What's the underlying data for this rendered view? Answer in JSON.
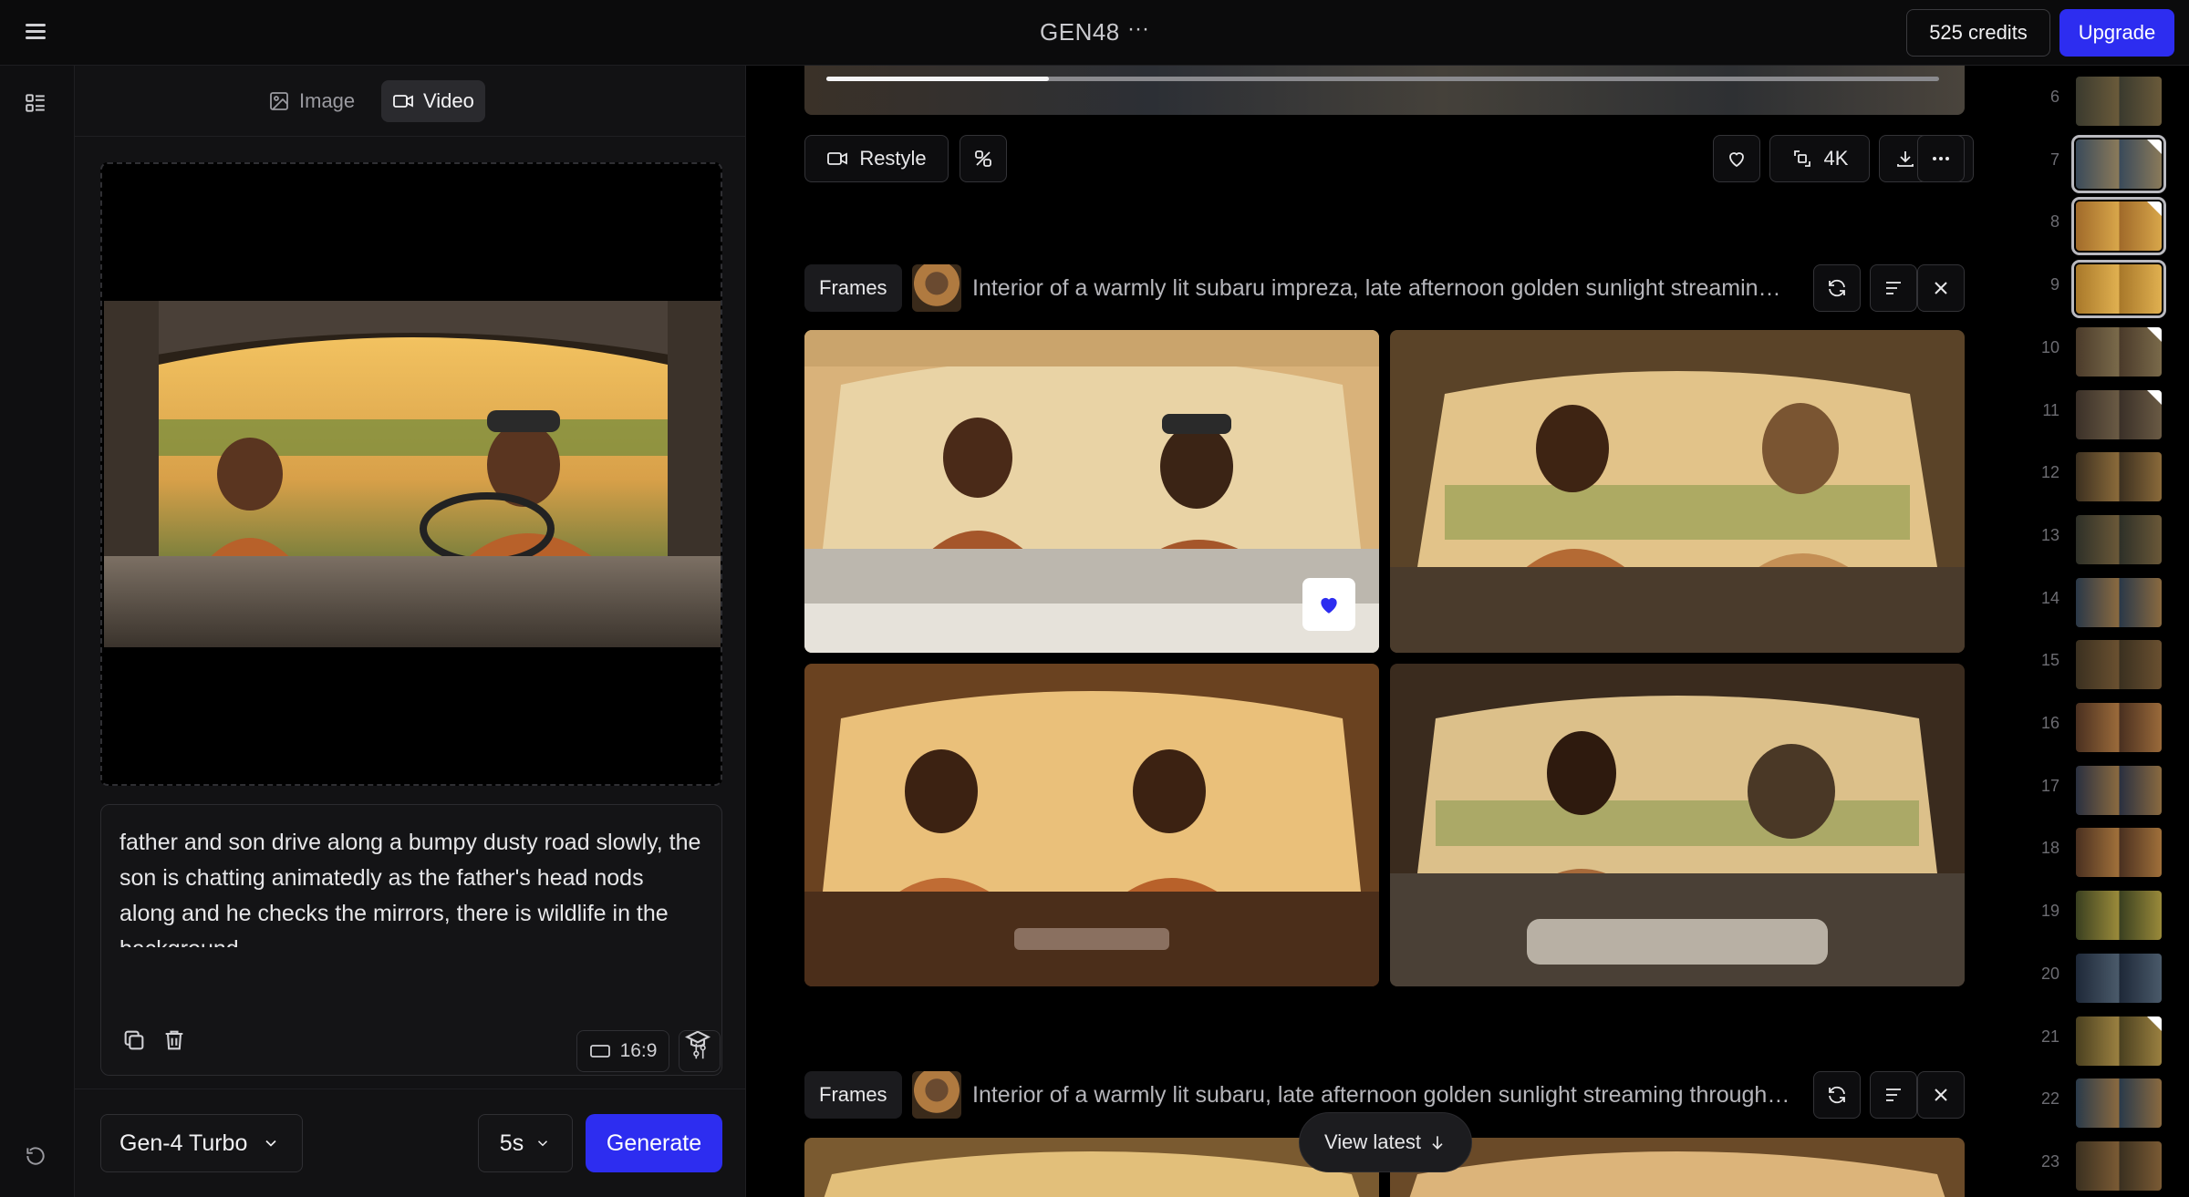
{
  "header": {
    "project_title": "GEN48",
    "more_label": "···",
    "credits_label": "525 credits",
    "upgrade_label": "Upgrade"
  },
  "mode_tabs": {
    "image_label": "Image",
    "video_label": "Video",
    "active": "Video"
  },
  "prompt": {
    "text": "father and son drive along a bumpy dusty road slowly, the son is chatting animatedly as the father's head nods along and he checks the mirrors, there is wildlife in the background"
  },
  "controls": {
    "aspect_ratio": "16:9",
    "model": "Gen-4 Turbo",
    "duration": "5s",
    "generate_label": "Generate"
  },
  "video_player": {
    "progress": 0.2
  },
  "toolbar": {
    "restyle_label": "Restyle",
    "upscale_label": "4K"
  },
  "generations": [
    {
      "chip_label": "Frames",
      "prompt": "Interior of a warmly lit subaru impreza, late afternoon golden sunlight streaming through the windows",
      "favorited_index": 0
    },
    {
      "chip_label": "Frames",
      "prompt": "Interior of a warmly lit subaru, late afternoon golden sunlight streaming through the windows"
    }
  ],
  "view_latest_label": "View latest",
  "timeline": {
    "items": [
      {
        "num": "6",
        "badge": false,
        "selected": false
      },
      {
        "num": "7",
        "badge": true,
        "selected": true
      },
      {
        "num": "8",
        "badge": true,
        "selected": true
      },
      {
        "num": "9",
        "badge": false,
        "selected": true
      },
      {
        "num": "10",
        "badge": true,
        "selected": false
      },
      {
        "num": "11",
        "badge": true,
        "selected": false
      },
      {
        "num": "12",
        "badge": false,
        "selected": false
      },
      {
        "num": "13",
        "badge": false,
        "selected": false
      },
      {
        "num": "14",
        "badge": false,
        "selected": false
      },
      {
        "num": "15",
        "badge": false,
        "selected": false
      },
      {
        "num": "16",
        "badge": false,
        "selected": false
      },
      {
        "num": "17",
        "badge": false,
        "selected": false
      },
      {
        "num": "18",
        "badge": false,
        "selected": false
      },
      {
        "num": "19",
        "badge": false,
        "selected": false
      },
      {
        "num": "20",
        "badge": false,
        "selected": false
      },
      {
        "num": "21",
        "badge": true,
        "selected": false
      },
      {
        "num": "22",
        "badge": false,
        "selected": false
      },
      {
        "num": "23",
        "badge": false,
        "selected": false
      }
    ]
  },
  "colors": {
    "accent": "#2d2df0",
    "background": "#000000",
    "panel": "#121214"
  }
}
